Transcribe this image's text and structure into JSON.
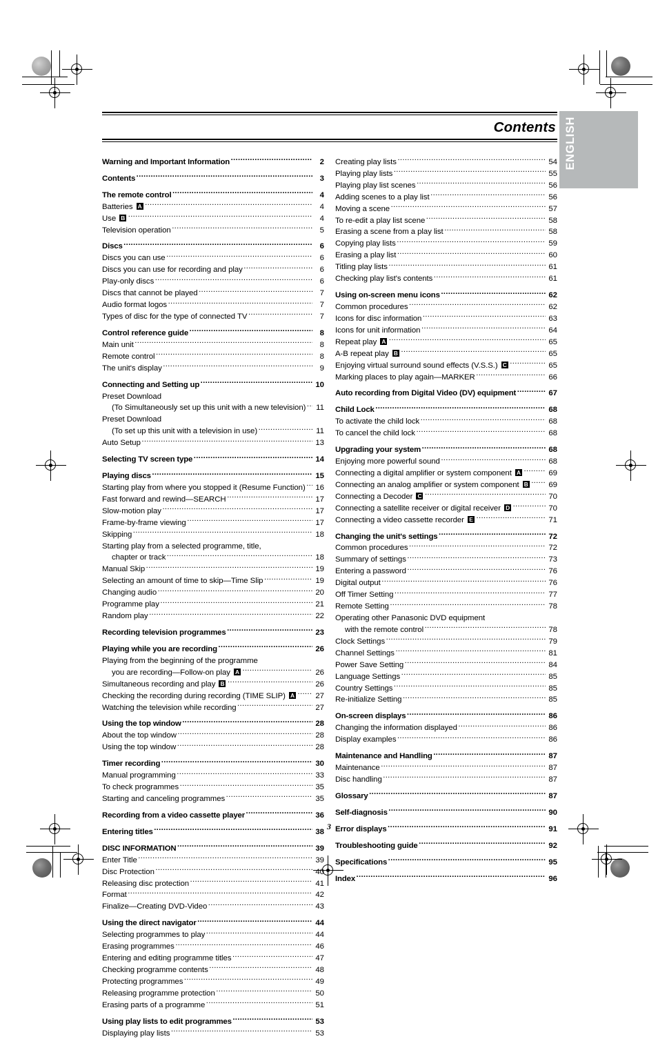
{
  "document": {
    "title": "Contents",
    "folio": "3",
    "language_tab": "ENGLISH"
  },
  "toc": {
    "left_column": [
      {
        "label": "Warning and Important Information",
        "page": "2",
        "bold": true,
        "gap_before": false
      },
      {
        "label": "Contents ",
        "page": "3",
        "bold": true,
        "gap_before": true
      },
      {
        "label": "The remote control ",
        "page": "4",
        "bold": true,
        "gap_before": true
      },
      {
        "label": "Batteries ",
        "badge": "A",
        "page": "4",
        "bold": false,
        "gap_before": false
      },
      {
        "label": "Use ",
        "badge": "B",
        "page": "4",
        "bold": false,
        "gap_before": false
      },
      {
        "label": "Television operation",
        "page": "5",
        "bold": false,
        "gap_before": false
      },
      {
        "label": "Discs ",
        "page": "6",
        "bold": true,
        "gap_before": true
      },
      {
        "label": "Discs you can use",
        "page": "6",
        "bold": false,
        "gap_before": false
      },
      {
        "label": "Discs you can use for recording and play ",
        "page": "6",
        "bold": false,
        "gap_before": false
      },
      {
        "label": "Play-only discs ",
        "page": "6",
        "bold": false,
        "gap_before": false
      },
      {
        "label": "Discs that cannot be played",
        "page": "7",
        "bold": false,
        "gap_before": false
      },
      {
        "label": "Audio format logos",
        "page": "7",
        "bold": false,
        "gap_before": false
      },
      {
        "label": "Types of disc for the type of connected TV ",
        "page": "7",
        "bold": false,
        "gap_before": false
      },
      {
        "label": "Control reference guide ",
        "page": "8",
        "bold": true,
        "gap_before": true
      },
      {
        "label": "Main unit ",
        "page": "8",
        "bold": false,
        "gap_before": false
      },
      {
        "label": "Remote control ",
        "page": "8",
        "bold": false,
        "gap_before": false
      },
      {
        "label": "The unit's display ",
        "page": "9",
        "bold": false,
        "gap_before": false
      },
      {
        "label": "Connecting and Setting up ",
        "page": "10",
        "bold": true,
        "gap_before": true
      },
      {
        "label": "Preset Download",
        "page": "",
        "bold": false,
        "gap_before": false,
        "noleader": true
      },
      {
        "label": "(To Simultaneously set up this unit with a new television) ",
        "page": "11",
        "bold": false,
        "gap_before": false,
        "cont": true
      },
      {
        "label": "Preset Download",
        "page": "",
        "bold": false,
        "gap_before": false,
        "noleader": true
      },
      {
        "label": "(To set up this unit with a television in use) ",
        "page": "11",
        "bold": false,
        "gap_before": false,
        "cont": true
      },
      {
        "label": "Auto Setup ",
        "page": "13",
        "bold": false,
        "gap_before": false
      },
      {
        "label": "Selecting TV screen type ",
        "page": "14",
        "bold": true,
        "gap_before": true
      },
      {
        "label": "Playing discs",
        "page": "15",
        "bold": true,
        "gap_before": true
      },
      {
        "label": "Starting play from where you stopped it (Resume Function)",
        "page": "16",
        "bold": false,
        "gap_before": false
      },
      {
        "label": "Fast forward and rewind—SEARCH",
        "page": "17",
        "bold": false,
        "gap_before": false
      },
      {
        "label": "Slow-motion play ",
        "page": "17",
        "bold": false,
        "gap_before": false
      },
      {
        "label": "Frame-by-frame viewing ",
        "page": "17",
        "bold": false,
        "gap_before": false
      },
      {
        "label": "Skipping ",
        "page": "18",
        "bold": false,
        "gap_before": false
      },
      {
        "label": "Starting play from a selected programme, title,",
        "page": "",
        "bold": false,
        "gap_before": false,
        "noleader": true
      },
      {
        "label": "chapter or track ",
        "page": "18",
        "bold": false,
        "gap_before": false,
        "cont": true
      },
      {
        "label": "Manual Skip ",
        "page": "19",
        "bold": false,
        "gap_before": false
      },
      {
        "label": "Selecting an amount of time to skip—Time Slip ",
        "page": "19",
        "bold": false,
        "gap_before": false
      },
      {
        "label": "Changing audio",
        "page": "20",
        "bold": false,
        "gap_before": false
      },
      {
        "label": "Programme play ",
        "page": "21",
        "bold": false,
        "gap_before": false
      },
      {
        "label": "Random play",
        "page": "22",
        "bold": false,
        "gap_before": false
      },
      {
        "label": "Recording television programmes",
        "page": "23",
        "bold": true,
        "gap_before": true
      },
      {
        "label": "Playing while you are recording",
        "page": "26",
        "bold": true,
        "gap_before": true
      },
      {
        "label": "Playing from the beginning of the programme",
        "page": "",
        "bold": false,
        "gap_before": false,
        "noleader": true
      },
      {
        "label": "you are recording—Follow-on play ",
        "badge": "A",
        "page": "26",
        "bold": false,
        "gap_before": false,
        "cont": true
      },
      {
        "label": "Simultaneous recording and play ",
        "badge": "B",
        "page": "26",
        "bold": false,
        "gap_before": false
      },
      {
        "label": "Checking the recording during recording (TIME SLIP) ",
        "badge": "A",
        "page": "27",
        "bold": false,
        "gap_before": false
      },
      {
        "label": "Watching the television while recording",
        "page": "27",
        "bold": false,
        "gap_before": false
      },
      {
        "label": "Using the top window",
        "page": "28",
        "bold": true,
        "gap_before": true
      },
      {
        "label": "About the top window ",
        "page": "28",
        "bold": false,
        "gap_before": false
      },
      {
        "label": "Using the top window",
        "page": "28",
        "bold": false,
        "gap_before": false
      },
      {
        "label": "Timer recording ",
        "page": "30",
        "bold": true,
        "gap_before": true
      },
      {
        "label": "Manual programming",
        "page": "33",
        "bold": false,
        "gap_before": false
      },
      {
        "label": "To check programmes ",
        "page": "35",
        "bold": false,
        "gap_before": false
      },
      {
        "label": "Starting and canceling programmes ",
        "page": "35",
        "bold": false,
        "gap_before": false
      },
      {
        "label": "Recording from a video cassette player",
        "page": "36",
        "bold": true,
        "gap_before": true
      },
      {
        "label": "Entering titles",
        "page": "38",
        "bold": true,
        "gap_before": true
      },
      {
        "label": "DISC INFORMATION",
        "page": "39",
        "bold": true,
        "gap_before": true
      },
      {
        "label": "Enter Title ",
        "page": "39",
        "bold": false,
        "gap_before": false
      },
      {
        "label": "Disc Protection",
        "page": "40",
        "bold": false,
        "gap_before": false
      },
      {
        "label": "Releasing disc protection",
        "page": "41",
        "bold": false,
        "gap_before": false
      },
      {
        "label": "Format ",
        "page": "42",
        "bold": false,
        "gap_before": false
      },
      {
        "label": "Finalize—Creating DVD-Video ",
        "page": "43",
        "bold": false,
        "gap_before": false
      },
      {
        "label": "Using the direct navigator ",
        "page": "44",
        "bold": true,
        "gap_before": true
      },
      {
        "label": "Selecting programmes to play ",
        "page": "44",
        "bold": false,
        "gap_before": false
      },
      {
        "label": "Erasing programmes ",
        "page": "46",
        "bold": false,
        "gap_before": false
      },
      {
        "label": "Entering and editing programme titles ",
        "page": "47",
        "bold": false,
        "gap_before": false
      },
      {
        "label": "Checking programme contents ",
        "page": "48",
        "bold": false,
        "gap_before": false
      },
      {
        "label": "Protecting programmes ",
        "page": "49",
        "bold": false,
        "gap_before": false
      },
      {
        "label": "Releasing programme protection",
        "page": "50",
        "bold": false,
        "gap_before": false
      },
      {
        "label": "Erasing parts of a programme ",
        "page": "51",
        "bold": false,
        "gap_before": false
      },
      {
        "label": "Using play lists to edit programmes",
        "page": "53",
        "bold": true,
        "gap_before": true
      },
      {
        "label": "Displaying play lists ",
        "page": "53",
        "bold": false,
        "gap_before": false
      }
    ],
    "right_column": [
      {
        "label": "Creating play lists",
        "page": "54",
        "bold": false,
        "gap_before": false
      },
      {
        "label": "Playing play lists",
        "page": "55",
        "bold": false,
        "gap_before": false
      },
      {
        "label": "Playing play list scenes ",
        "page": "56",
        "bold": false,
        "gap_before": false
      },
      {
        "label": "Adding scenes to a play list",
        "page": "56",
        "bold": false,
        "gap_before": false
      },
      {
        "label": "Moving a scene ",
        "page": "57",
        "bold": false,
        "gap_before": false
      },
      {
        "label": "To re-edit a play list scene ",
        "page": "58",
        "bold": false,
        "gap_before": false
      },
      {
        "label": "Erasing a scene from a play list ",
        "page": "58",
        "bold": false,
        "gap_before": false
      },
      {
        "label": "Copying play lists ",
        "page": "59",
        "bold": false,
        "gap_before": false
      },
      {
        "label": "Erasing a play list ",
        "page": "60",
        "bold": false,
        "gap_before": false
      },
      {
        "label": "Titling play lists ",
        "page": "61",
        "bold": false,
        "gap_before": false
      },
      {
        "label": "Checking play list's contents ",
        "page": "61",
        "bold": false,
        "gap_before": false
      },
      {
        "label": "Using on-screen menu icons ",
        "page": "62",
        "bold": true,
        "gap_before": true
      },
      {
        "label": "Common procedures",
        "page": "62",
        "bold": false,
        "gap_before": false
      },
      {
        "label": "Icons for disc information ",
        "page": "63",
        "bold": false,
        "gap_before": false
      },
      {
        "label": "Icons for unit information ",
        "page": "64",
        "bold": false,
        "gap_before": false
      },
      {
        "label": "Repeat play ",
        "badge": "A",
        "page": "65",
        "bold": false,
        "gap_before": false
      },
      {
        "label": "A-B repeat play ",
        "badge": "B",
        "page": "65",
        "bold": false,
        "gap_before": false
      },
      {
        "label": "Enjoying virtual surround sound effects (V.S.S.) ",
        "badge": "C",
        "page": "65",
        "bold": false,
        "gap_before": false
      },
      {
        "label": "Marking places to play again—MARKER",
        "page": "66",
        "bold": false,
        "gap_before": false
      },
      {
        "label": "Auto recording from Digital Video (DV) equipment ",
        "page": "67",
        "bold": true,
        "gap_before": true
      },
      {
        "label": "Child Lock",
        "page": "68",
        "bold": true,
        "gap_before": true
      },
      {
        "label": "To activate the child lock",
        "page": "68",
        "bold": false,
        "gap_before": false
      },
      {
        "label": "To cancel the child lock ",
        "page": "68",
        "bold": false,
        "gap_before": false
      },
      {
        "label": "Upgrading your system ",
        "page": "68",
        "bold": true,
        "gap_before": true
      },
      {
        "label": "Enjoying more powerful sound",
        "page": "68",
        "bold": false,
        "gap_before": false
      },
      {
        "label": "Connecting a digital amplifier or system component ",
        "badge": "A",
        "page": "69",
        "bold": false,
        "gap_before": false
      },
      {
        "label": "Connecting an analog amplifier or system component ",
        "badge": "B",
        "page": "69",
        "bold": false,
        "gap_before": false
      },
      {
        "label": "Connecting a Decoder ",
        "badge": "C",
        "page": "70",
        "bold": false,
        "gap_before": false
      },
      {
        "label": "Connecting a satellite receiver or digital receiver ",
        "badge": "D",
        "page": "70",
        "bold": false,
        "gap_before": false
      },
      {
        "label": "Connecting a video cassette recorder ",
        "badge": "E",
        "page": "71",
        "bold": false,
        "gap_before": false
      },
      {
        "label": "Changing the unit's settings",
        "page": "72",
        "bold": true,
        "gap_before": true
      },
      {
        "label": "Common procedures",
        "page": "72",
        "bold": false,
        "gap_before": false
      },
      {
        "label": "Summary of settings ",
        "page": "73",
        "bold": false,
        "gap_before": false
      },
      {
        "label": "Entering a password ",
        "page": "76",
        "bold": false,
        "gap_before": false
      },
      {
        "label": "Digital output ",
        "page": "76",
        "bold": false,
        "gap_before": false
      },
      {
        "label": "Off Timer Setting ",
        "page": "77",
        "bold": false,
        "gap_before": false
      },
      {
        "label": "Remote Setting ",
        "page": "78",
        "bold": false,
        "gap_before": false
      },
      {
        "label": "Operating other Panasonic DVD equipment",
        "page": "",
        "bold": false,
        "gap_before": false,
        "noleader": true
      },
      {
        "label": "with the remote control ",
        "page": "78",
        "bold": false,
        "gap_before": false,
        "cont": true
      },
      {
        "label": "Clock Settings ",
        "page": "79",
        "bold": false,
        "gap_before": false
      },
      {
        "label": "Channel Settings",
        "page": "81",
        "bold": false,
        "gap_before": false
      },
      {
        "label": "Power Save Setting",
        "page": "84",
        "bold": false,
        "gap_before": false
      },
      {
        "label": "Language Settings ",
        "page": "85",
        "bold": false,
        "gap_before": false
      },
      {
        "label": "Country Settings",
        "page": "85",
        "bold": false,
        "gap_before": false
      },
      {
        "label": "Re-initialize Setting ",
        "page": "85",
        "bold": false,
        "gap_before": false
      },
      {
        "label": "On-screen displays ",
        "page": "86",
        "bold": true,
        "gap_before": true
      },
      {
        "label": "Changing the information displayed",
        "page": "86",
        "bold": false,
        "gap_before": false
      },
      {
        "label": "Display examples ",
        "page": "86",
        "bold": false,
        "gap_before": false
      },
      {
        "label": "Maintenance and Handling",
        "page": "87",
        "bold": true,
        "gap_before": true
      },
      {
        "label": "Maintenance",
        "page": "87",
        "bold": false,
        "gap_before": false
      },
      {
        "label": "Disc handling",
        "page": "87",
        "bold": false,
        "gap_before": false
      },
      {
        "label": "Glossary ",
        "page": "87",
        "bold": true,
        "gap_before": true
      },
      {
        "label": "Self-diagnosis",
        "page": "90",
        "bold": true,
        "gap_before": true
      },
      {
        "label": "Error displays ",
        "page": "91",
        "bold": true,
        "gap_before": true
      },
      {
        "label": "Troubleshooting guide ",
        "page": "92",
        "bold": true,
        "gap_before": true
      },
      {
        "label": "Specifications",
        "page": "95",
        "bold": true,
        "gap_before": true
      },
      {
        "label": "Index",
        "page": "96",
        "bold": true,
        "gap_before": true
      }
    ]
  }
}
